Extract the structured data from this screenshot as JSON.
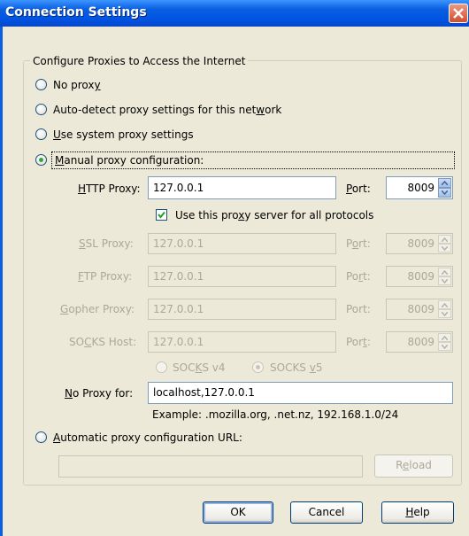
{
  "window": {
    "title": "Connection Settings"
  },
  "group": {
    "legend": "Configure Proxies to Access the Internet"
  },
  "options": {
    "no_proxy": {
      "pre": "No prox",
      "key": "y",
      "post": ""
    },
    "auto_detect": {
      "pre": "Auto-detect proxy settings for this net",
      "key": "w",
      "post": "ork"
    },
    "system": {
      "pre": "",
      "key": "U",
      "post": "se system proxy settings"
    },
    "manual": {
      "pre": "",
      "key": "M",
      "post": "anual proxy configuration:"
    },
    "auto_url": {
      "pre": "",
      "key": "A",
      "post": "utomatic proxy configuration URL:"
    }
  },
  "http": {
    "pre": "",
    "key": "H",
    "post": "TTP Proxy:",
    "value": "127.0.0.1",
    "port_pre": "",
    "port_key": "P",
    "port_post": "ort:",
    "port": "8009"
  },
  "use_all": {
    "pre": "Use this pro",
    "key": "x",
    "post": "y server for all protocols",
    "checked": true
  },
  "ssl": {
    "pre": "",
    "key": "S",
    "post": "SL Proxy:",
    "value": "127.0.0.1",
    "port_pre": "P",
    "port_key": "o",
    "port_post": "rt:",
    "port": "8009"
  },
  "ftp": {
    "pre": "",
    "key": "F",
    "post": "TP Proxy:",
    "value": "127.0.0.1",
    "port_pre": "Po",
    "port_key": "r",
    "port_post": "t:",
    "port": "8009"
  },
  "gopher": {
    "pre": "",
    "key": "G",
    "post": "opher Proxy:",
    "value": "127.0.0.1",
    "port_pre": "Port:",
    "port_key": "",
    "port_post": "",
    "port": "8009"
  },
  "socks": {
    "pre": "SO",
    "key": "C",
    "post": "KS Host:",
    "value": "127.0.0.1",
    "port_pre": "Por",
    "port_key": "t",
    "port_post": ":",
    "port": "8009"
  },
  "socks_v4": {
    "pre": "SOC",
    "key": "K",
    "post": "S v4"
  },
  "socks_v5": {
    "pre": "SOCKS ",
    "key": "v",
    "post": "5"
  },
  "no_proxy_for": {
    "pre": "",
    "key": "N",
    "post": "o Proxy for:",
    "value": "localhost,127.0.0.1",
    "example": "Example: .mozilla.org, .net.nz, 192.168.1.0/24"
  },
  "auto_url_value": "",
  "buttons": {
    "reload": {
      "pre": "R",
      "key": "e",
      "post": "load"
    },
    "ok": "OK",
    "cancel": "Cancel",
    "help": {
      "pre": "",
      "key": "H",
      "post": "elp"
    }
  }
}
